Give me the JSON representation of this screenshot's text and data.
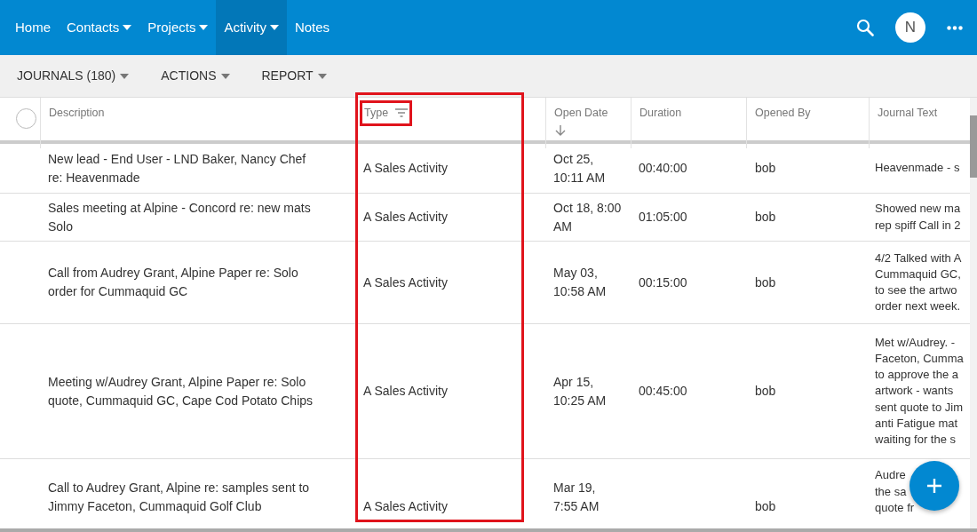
{
  "nav": {
    "items": [
      {
        "label": "Home",
        "dropdown": false,
        "selected": false
      },
      {
        "label": "Contacts",
        "dropdown": true,
        "selected": false
      },
      {
        "label": "Projects",
        "dropdown": true,
        "selected": false
      },
      {
        "label": "Activity",
        "dropdown": true,
        "selected": true
      },
      {
        "label": "Notes",
        "dropdown": false,
        "selected": false
      }
    ],
    "avatar": "N"
  },
  "toolbar": {
    "menus": [
      {
        "label": "JOURNALS (180)",
        "dropdown": true
      },
      {
        "label": "ACTIONS",
        "dropdown": true
      },
      {
        "label": "REPORT",
        "dropdown": true
      }
    ]
  },
  "table": {
    "select_all": {
      "checked": false
    },
    "columns": [
      {
        "label": "Description",
        "sorted_descending": false,
        "filter": false,
        "highlighted": false
      },
      {
        "label": "Type",
        "sorted_descending": false,
        "filter": true,
        "highlighted": true
      },
      {
        "label": "Open Date",
        "sorted_descending": true,
        "filter": false,
        "highlighted": false
      },
      {
        "label": "Duration",
        "sorted_descending": false,
        "filter": false,
        "highlighted": false
      },
      {
        "label": "Opened By",
        "sorted_descending": false,
        "filter": false,
        "highlighted": false
      },
      {
        "label": "Journal Text",
        "sorted_descending": false,
        "filter": false,
        "highlighted": false
      }
    ],
    "rows": [
      {
        "description": "New lead - End User - LND Baker, Nancy Chef re: Heavenmade",
        "type": "A Sales Activity",
        "open_date": "Oct 25, 10:11 AM",
        "duration": "00:40:00",
        "opened_by": "bob",
        "journal_text": [
          "Heavenmade - s"
        ]
      },
      {
        "description": "Sales meeting at Alpine - Concord re: new mats Solo",
        "type": "A Sales Activity",
        "open_date": "Oct 18, 8:00 AM",
        "duration": "01:05:00",
        "opened_by": "bob",
        "journal_text": [
          "Showed new ma",
          "rep spiff Call in 2"
        ]
      },
      {
        "description": "Call from Audrey Grant, Alpine Paper re: Solo order for Cummaquid GC",
        "type": "A Sales Activity",
        "open_date": "May 03, 10:58 AM",
        "duration": "00:15:00",
        "opened_by": "bob",
        "journal_text": [
          "4/2 Talked with A",
          "Cummaquid GC,",
          "to see the artwo",
          "order next week."
        ]
      },
      {
        "description": "Meeting w/Audrey Grant, Alpine Paper re: Solo quote, Cummaquid GC, Cape Cod Potato Chips",
        "type": "A Sales Activity",
        "open_date": "Apr 15, 10:25 AM",
        "duration": "00:45:00",
        "opened_by": "bob",
        "journal_text": [
          "Met w/Audrey. -",
          "Faceton, Cumma",
          "to approve the a",
          "artwork - wants",
          "sent quote to Jim",
          "anti Fatigue mat",
          "waiting for the s"
        ]
      },
      {
        "description": "Call to Audrey Grant, Alpine re: samples sent to Jimmy Faceton, Cummaquid Golf Club",
        "type": "A Sales Activity",
        "open_date": "Mar 19, 7:55 AM",
        "opened_by": "bob",
        "journal_text": [
          "Audre",
          "the sa",
          "quote fr"
        ]
      }
    ]
  }
}
